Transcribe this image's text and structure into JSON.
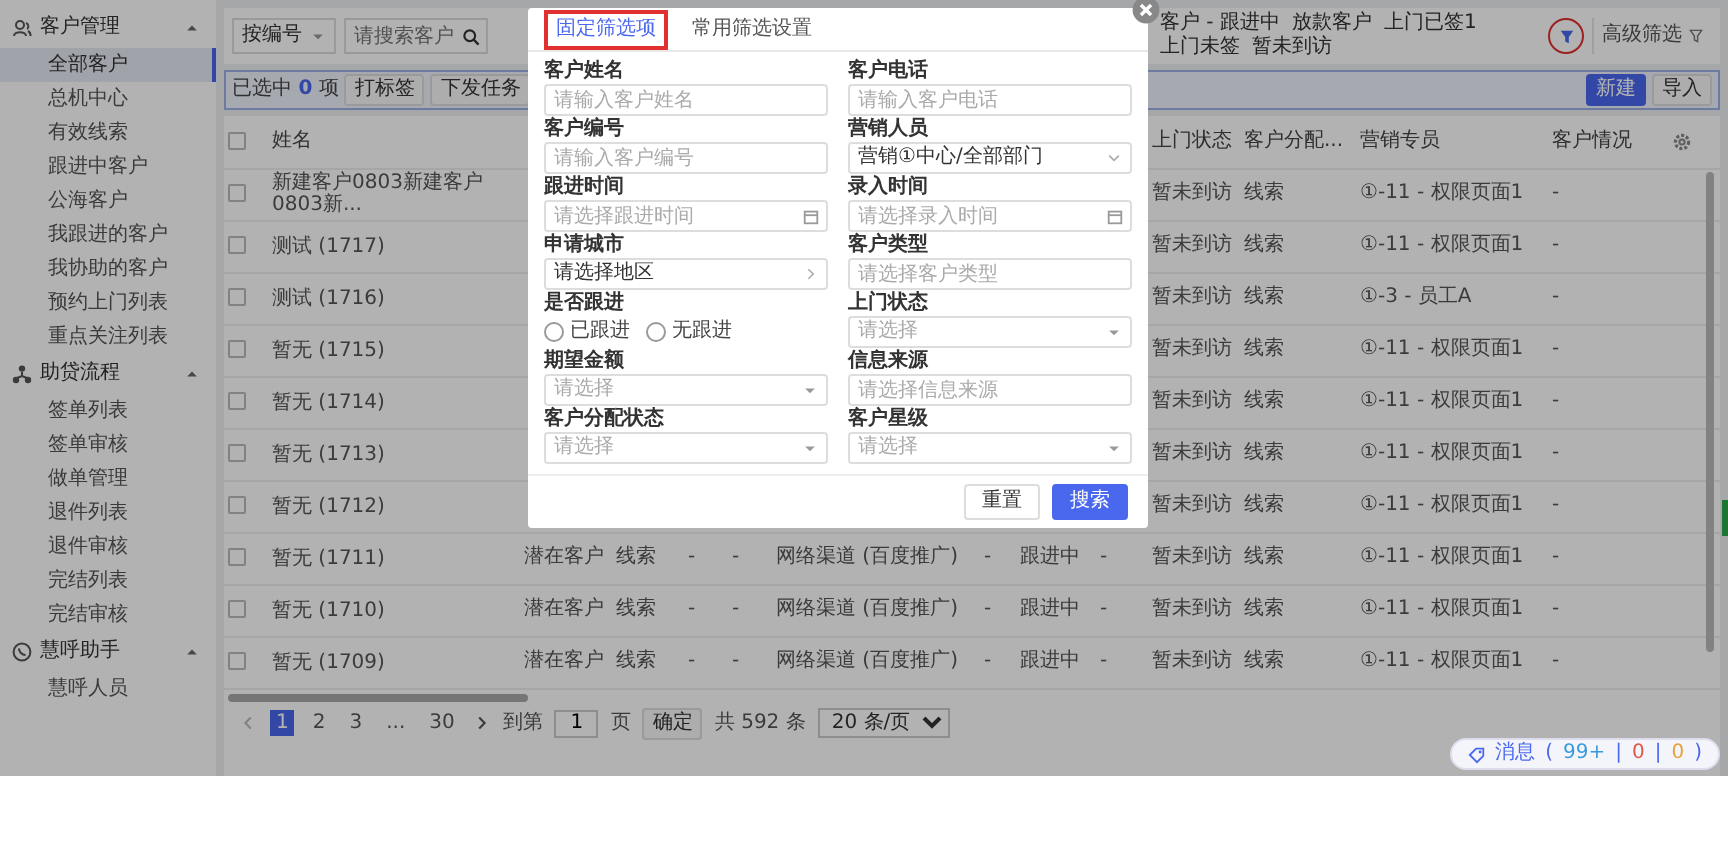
{
  "sidebar": {
    "sections": [
      {
        "title": "客户管理",
        "expanded": true,
        "items": [
          {
            "label": "全部客户",
            "selected": true
          },
          {
            "label": "总机中心",
            "selected": false
          },
          {
            "label": "有效线索",
            "selected": false
          },
          {
            "label": "跟进中客户",
            "selected": false
          },
          {
            "label": "公海客户",
            "selected": false
          },
          {
            "label": "我跟进的客户",
            "selected": false
          },
          {
            "label": "我协助的客户",
            "selected": false
          },
          {
            "label": "预约上门列表",
            "selected": false
          },
          {
            "label": "重点关注列表",
            "selected": false
          }
        ]
      },
      {
        "title": "助贷流程",
        "expanded": true,
        "items": [
          {
            "label": "签单列表",
            "selected": false
          },
          {
            "label": "签单审核",
            "selected": false
          },
          {
            "label": "做单管理",
            "selected": false
          },
          {
            "label": "退件列表",
            "selected": false
          },
          {
            "label": "退件审核",
            "selected": false
          },
          {
            "label": "完结列表",
            "selected": false
          },
          {
            "label": "完结审核",
            "selected": false
          }
        ]
      },
      {
        "title": "慧呼助手",
        "expanded": true,
        "items": [
          {
            "label": "慧呼人员",
            "selected": false
          }
        ]
      }
    ]
  },
  "toolbar": {
    "search_type": "按编号",
    "search": {
      "placeholder": "请搜索客户"
    },
    "quick_filters": [
      "客户 - 跟进中",
      "放款客户",
      "上门已签1",
      "上门未签",
      "暂未到访"
    ],
    "filter_button": {
      "circled": true
    },
    "advanced_filter": "高级筛选"
  },
  "selection_bar": {
    "prefix": "已选中",
    "count": "0",
    "suffix": "项",
    "actions": [
      "打标签",
      "下发任务"
    ],
    "buttons": [
      {
        "label": "新建",
        "kind": "primary"
      },
      {
        "label": "导入",
        "kind": "default"
      }
    ]
  },
  "table": {
    "all_checked": false,
    "name_header": "姓名",
    "right_headers": [
      "上门状态",
      "客户分配...",
      "营销专员",
      "客户情况"
    ],
    "rows": [
      {
        "checked": false,
        "name": "新建客户0803新建客户0803新...",
        "right": [
          "暂未到访",
          "线索",
          "①-11 - 权限页面1",
          "-"
        ]
      },
      {
        "checked": false,
        "name": "测试 (1717)",
        "right": [
          "暂未到访",
          "线索",
          "①-11 - 权限页面1",
          "-"
        ]
      },
      {
        "checked": false,
        "name": "测试 (1716)",
        "right": [
          "暂未到访",
          "线索",
          "①-3 - 员工A",
          "-"
        ]
      },
      {
        "checked": false,
        "name": "暂无 (1715)",
        "right": [
          "暂未到访",
          "线索",
          "①-11 - 权限页面1",
          "-"
        ]
      },
      {
        "checked": false,
        "name": "暂无 (1714)",
        "right": [
          "暂未到访",
          "线索",
          "①-11 - 权限页面1",
          "-"
        ]
      },
      {
        "checked": false,
        "name": "暂无 (1713)",
        "right": [
          "暂未到访",
          "线索",
          "①-11 - 权限页面1",
          "-"
        ]
      },
      {
        "checked": false,
        "name": "暂无 (1712)",
        "right": [
          "暂未到访",
          "线索",
          "①-11 - 权限页面1",
          "-"
        ]
      },
      {
        "checked": false,
        "name": "暂无 (1711)",
        "middle": [
          "潜在客户",
          "线索",
          "-",
          "-",
          "网络渠道 (百度推广)",
          "-",
          "跟进中",
          "-"
        ],
        "right": [
          "暂未到访",
          "线索",
          "①-11 - 权限页面1",
          "-"
        ]
      },
      {
        "checked": false,
        "name": "暂无 (1710)",
        "middle": [
          "潜在客户",
          "线索",
          "-",
          "-",
          "网络渠道 (百度推广)",
          "-",
          "跟进中",
          "-"
        ],
        "right": [
          "暂未到访",
          "线索",
          "①-11 - 权限页面1",
          "-"
        ]
      },
      {
        "checked": false,
        "name": "暂无 (1709)",
        "middle": [
          "潜在客户",
          "线索",
          "-",
          "-",
          "网络渠道 (百度推广)",
          "-",
          "跟进中",
          "-"
        ],
        "right": [
          "暂未到访",
          "线索",
          "①-11 - 权限页面1",
          "-"
        ]
      }
    ]
  },
  "pagination": {
    "prev_disabled": true,
    "next_disabled": false,
    "pages": [
      {
        "label": "1",
        "selected": true
      },
      {
        "label": "2",
        "selected": false
      },
      {
        "label": "3",
        "selected": false
      },
      {
        "label": "...",
        "selected": false
      },
      {
        "label": "30",
        "selected": false
      }
    ],
    "goto_label": "到第",
    "goto_value": "1",
    "page_unit": "页",
    "confirm": "确定",
    "total": "共 592 条",
    "page_size": "20 条/页"
  },
  "messages": {
    "label": "消息",
    "open": "(",
    "separator": "|",
    "close": ")",
    "counts": [
      {
        "value": "99+",
        "color": "#3a9bd9"
      },
      {
        "value": "0",
        "color": "#e0574a"
      },
      {
        "value": "0",
        "color": "#e6a23c"
      }
    ]
  },
  "modal": {
    "tabs": [
      {
        "label": "固定筛选项",
        "selected": true,
        "outlined": true
      },
      {
        "label": "常用筛选设置",
        "selected": false,
        "outlined": false
      }
    ],
    "fields": [
      {
        "label": "客户姓名",
        "kind": "input",
        "placeholder": "请输入客户姓名"
      },
      {
        "label": "客户电话",
        "kind": "input",
        "placeholder": "请输入客户电话"
      },
      {
        "label": "客户编号",
        "kind": "input",
        "placeholder": "请输入客户编号"
      },
      {
        "label": "营销人员",
        "kind": "select",
        "value": "营销①中心/全部部门"
      },
      {
        "label": "跟进时间",
        "kind": "date",
        "placeholder": "请选择跟进时间"
      },
      {
        "label": "录入时间",
        "kind": "date",
        "placeholder": "请选择录入时间"
      },
      {
        "label": "申请城市",
        "kind": "cascader",
        "value": "请选择地区"
      },
      {
        "label": "客户类型",
        "kind": "input",
        "placeholder": "请选择客户类型"
      },
      {
        "label": "是否跟进",
        "kind": "radio",
        "options": [
          {
            "label": "已跟进",
            "checked": false
          },
          {
            "label": "无跟进",
            "checked": false
          }
        ]
      },
      {
        "label": "上门状态",
        "kind": "select",
        "placeholder": "请选择"
      },
      {
        "label": "期望金额",
        "kind": "select",
        "placeholder": "请选择"
      },
      {
        "label": "信息来源",
        "kind": "input",
        "placeholder": "请选择信息来源"
      },
      {
        "label": "客户分配状态",
        "kind": "select",
        "placeholder": "请选择"
      },
      {
        "label": "客户星级",
        "kind": "select",
        "placeholder": "请选择"
      }
    ],
    "buttons": [
      {
        "label": "重置",
        "kind": "default"
      },
      {
        "label": "搜索",
        "kind": "primary"
      }
    ]
  }
}
